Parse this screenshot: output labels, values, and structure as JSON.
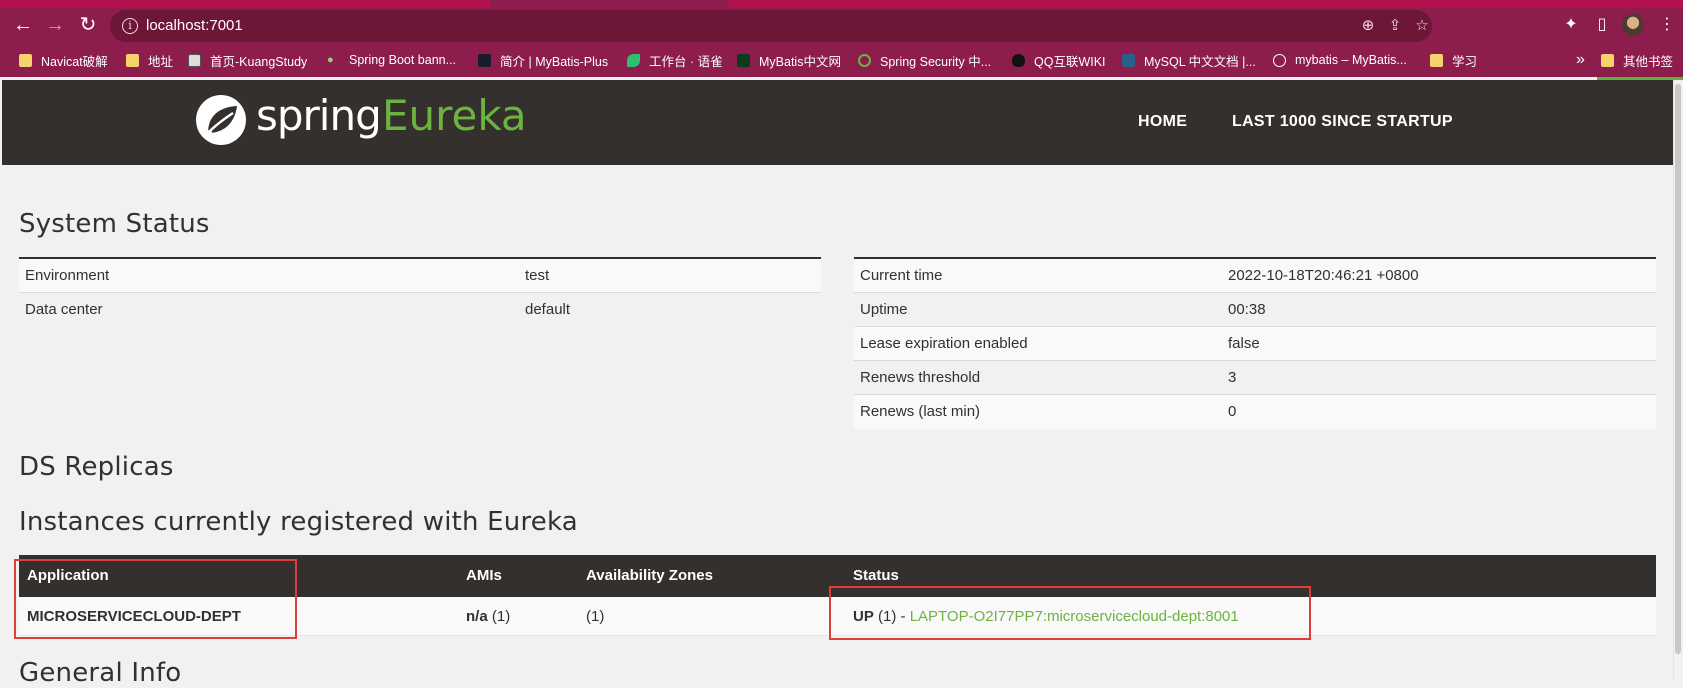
{
  "browser": {
    "url": "localhost:7001",
    "nav": {
      "back": "←",
      "forward": "→",
      "reload": "↻"
    },
    "bookmarks": [
      {
        "label": "Navicat破解",
        "icon": "folder"
      },
      {
        "label": "地址",
        "icon": "folder"
      },
      {
        "label": "首页-KuangStudy",
        "icon": "favicon"
      },
      {
        "label": "Spring Boot bann...",
        "icon": "favicon"
      },
      {
        "label": "简介 | MyBatis-Plus",
        "icon": "favicon"
      },
      {
        "label": "工作台 · 语雀",
        "icon": "favicon"
      },
      {
        "label": "MyBatis中文网",
        "icon": "favicon"
      },
      {
        "label": "Spring Security 中...",
        "icon": "favicon"
      },
      {
        "label": "QQ互联WIKI",
        "icon": "favicon"
      },
      {
        "label": "MySQL 中文文档 |...",
        "icon": "favicon"
      },
      {
        "label": "mybatis – MyBatis...",
        "icon": "globe"
      },
      {
        "label": "学习",
        "icon": "folder"
      }
    ],
    "overflow": "»",
    "other_bookmarks": "其他书签"
  },
  "header": {
    "logo_spring": "spring",
    "logo_eureka": "Eureka",
    "nav": [
      "HOME",
      "LAST 1000 SINCE STARTUP"
    ]
  },
  "system_status": {
    "title": "System Status",
    "left": [
      {
        "key": "Environment",
        "value": "test"
      },
      {
        "key": "Data center",
        "value": "default"
      }
    ],
    "right": [
      {
        "key": "Current time",
        "value": "2022-10-18T20:46:21 +0800"
      },
      {
        "key": "Uptime",
        "value": "00:38"
      },
      {
        "key": "Lease expiration enabled",
        "value": "false"
      },
      {
        "key": "Renews threshold",
        "value": "3"
      },
      {
        "key": "Renews (last min)",
        "value": "0"
      }
    ]
  },
  "ds_replicas": {
    "title": "DS Replicas"
  },
  "instances": {
    "title": "Instances currently registered with Eureka",
    "headers": [
      "Application",
      "AMIs",
      "Availability Zones",
      "Status"
    ],
    "rows": [
      {
        "application": "MICROSERVICECLOUD-DEPT",
        "amis_bold": "n/a",
        "amis_count": "(1)",
        "zones": "(1)",
        "status_bold": "UP",
        "status_count": "(1) -",
        "status_link": "LAPTOP-O2I77PP7:microservicecloud-dept:8001"
      }
    ]
  },
  "general_info": {
    "title": "General Info"
  },
  "colors": {
    "chrome": "#8c1d4c",
    "header": "#34302d",
    "spring_green": "#6db33f",
    "highlight": "#e03c3c"
  }
}
